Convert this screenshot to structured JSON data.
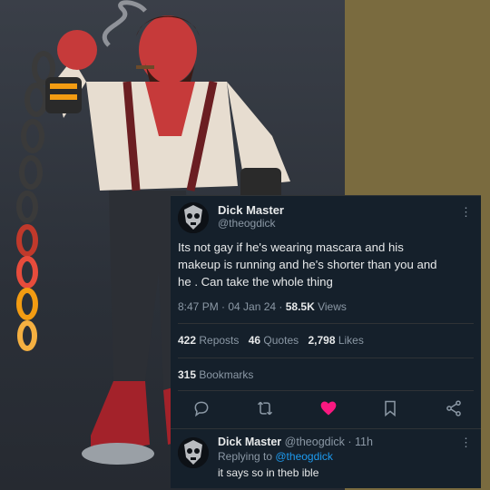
{
  "tweet": {
    "author_name": "Dick Master",
    "author_handle": "@theogdick",
    "more_glyph": "⋮",
    "text_line1": "Its not gay if he's wearing mascara and his",
    "text_line2": "makeup is running and he's shorter than you and",
    "text_line3": "he . Can take the whole thing",
    "time": "8:47 PM · 04 Jan 24 · ",
    "views_count": "58.5K",
    "views_label": " Views",
    "reposts_count": "422",
    "reposts_label": " Reposts",
    "quotes_count": "46",
    "quotes_label": " Quotes",
    "likes_count": "2,798",
    "likes_label": " Likes",
    "bookmarks_count": "315",
    "bookmarks_label": " Bookmarks"
  },
  "reply": {
    "author_name": "Dick Master",
    "author_handle": "@theogdick",
    "time": " · 11h",
    "replying_to_label": "Replying to ",
    "replying_to_handle": "@theogdick",
    "text": "it says so in theb ible",
    "more_glyph": "⋮"
  },
  "icons": [
    "reply-icon",
    "repost-icon",
    "like-icon",
    "bookmark-icon",
    "share-icon"
  ],
  "colors": {
    "background": "#15202b",
    "accent": "#1d9bf0",
    "like": "#f91880",
    "muted": "#8b98a5"
  }
}
